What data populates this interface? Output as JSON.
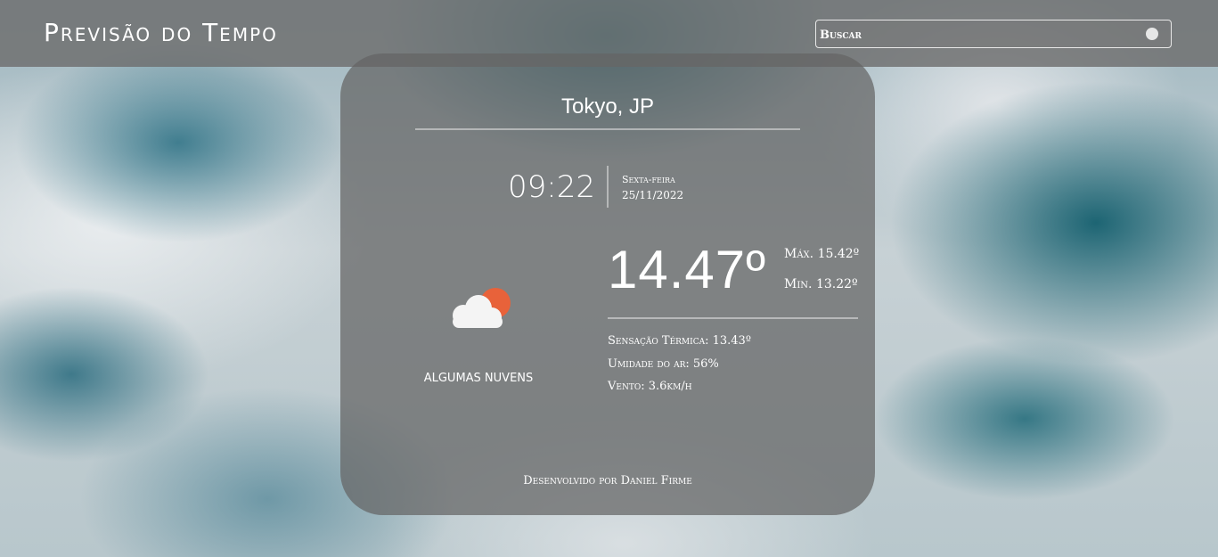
{
  "header": {
    "title": "Previsão do Tempo",
    "search_placeholder": "Buscar",
    "search_value": ""
  },
  "weather": {
    "city": "Tokyo, JP",
    "time": "09:22",
    "weekday": "Sexta-feira",
    "date": "25/11/2022",
    "temperature": "14.47º",
    "max_label": "Máx.",
    "max_value": "15.42º",
    "min_label": "Min.",
    "min_value": "13.22º",
    "condition": "ALGUMAS NUVENS",
    "icon": "cloud-sun-icon",
    "feels_like_label": "Sensação Térmica:",
    "feels_like_value": "13.43º",
    "humidity_label": "Umidade do ar:",
    "humidity_value": "56%",
    "wind_label": "Vento:",
    "wind_value": "3.6km/h"
  },
  "footer": {
    "credit": "Desenvolvido por Daniel Firme"
  },
  "colors": {
    "sun": "#e8623a",
    "cloud": "#f4f4f4",
    "card": "#646464",
    "topbar": "#6e6e6e"
  }
}
